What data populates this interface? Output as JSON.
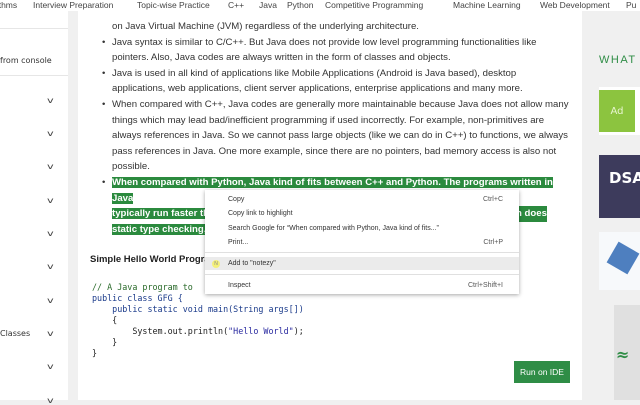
{
  "topnav": [
    "rithms",
    "Interview Preparation",
    "Topic-wise Practice",
    "C++",
    "Java",
    "Python",
    "Competitive Programming",
    "Machine Learning",
    "Web Development",
    "Pu"
  ],
  "sidebar": {
    "items": [
      "from console",
      "",
      "",
      "",
      "",
      "",
      "",
      "",
      "Classes",
      "",
      ""
    ]
  },
  "article": {
    "bullets": [
      "on Java Virtual Machine (JVM) regardless of the underlying architecture.",
      "Java syntax is similar to C/C++. But Java does not provide low level programming functionalities like pointers. Also, Java codes are always written in the form of classes and objects.",
      "Java is used in all kind of applications like Mobile Applications (Android is Java based), desktop applications, web applications, client server applications, enterprise applications and many more.",
      "When compared with C++, Java codes are generally more maintainable because Java does not allow many things which may lead bad/inefficient programming if used incorrectly. For example, non-primitives are always references in Java. So we cannot pass large objects (like we can do in C++) to functions, we always pass references in Java. One more example, since there are no pointers, bad memory access is also not possible."
    ],
    "highlighted": {
      "line1": "When compared with Python, Java kind of fits between C++ and Python. The programs written in Java",
      "line2a": "typically run faster th",
      "line2b": "n does",
      "line3": "static type checking,"
    },
    "heading": "Simple Hello World Progra",
    "code": [
      "// A Java program to",
      "public class GFG {",
      "    public static void main(String args[])",
      "    {",
      "        System.out.println(",
      "\"Hello World\"",
      ");",
      "    }",
      "}"
    ],
    "run_label": "Run on IDE"
  },
  "context_menu": {
    "items": [
      {
        "label": "Copy",
        "shortcut": "Ctrl+C"
      },
      {
        "label": "Copy link to highlight",
        "shortcut": ""
      },
      {
        "label": "Search Google for “When compared with Python, Java kind of fits...”",
        "shortcut": ""
      },
      {
        "label": "Print...",
        "shortcut": "Ctrl+P"
      },
      {
        "label": "Add to \"notezy\"",
        "shortcut": ""
      },
      {
        "label": "Inspect",
        "shortcut": "Ctrl+Shift+I"
      }
    ],
    "notezy_icon": "N"
  },
  "right": {
    "heading": "WHAT",
    "ad_label": "Ad",
    "dsa_label": "DSA"
  },
  "colors": {
    "accent": "#2f8d46",
    "highlight": "#2b8a3e"
  }
}
